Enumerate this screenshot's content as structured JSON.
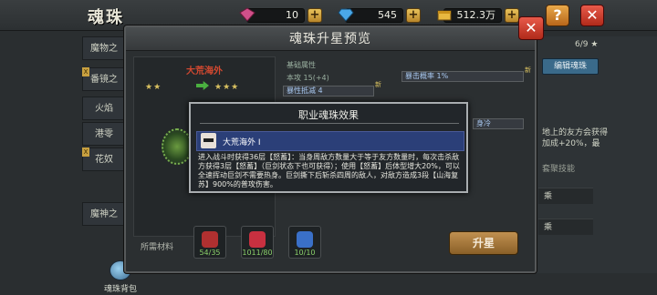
{
  "header": {
    "title": "魂珠",
    "resources": [
      {
        "icon": "pink-gem-icon",
        "value": "10",
        "color": "#d0508a"
      },
      {
        "icon": "blue-diamond-icon",
        "value": "545",
        "color": "#4aa8e8"
      },
      {
        "icon": "gold-chest-icon",
        "value": "512.3万",
        "color": "#e8b840"
      }
    ],
    "help_label": "?",
    "close_label": "✕"
  },
  "sidebar": {
    "items": [
      "魔物之",
      "番镜之",
      "火焰",
      "港零",
      "花奴",
      "魔神之"
    ],
    "bag_label": "魂珠背包"
  },
  "right_panel": {
    "count": "6/9 ★",
    "button_label": "编辑魂珠",
    "text": "地上的友方会获得加成+20%，最",
    "section": "套聚技能",
    "row1": "乘",
    "row2": "乘"
  },
  "dialog": {
    "title": "魂珠升星预览",
    "close_label": "✕",
    "card": {
      "name": "大荒海外",
      "stars_left": "★★",
      "stars_right": "★★★"
    },
    "attrs": {
      "base_label": "基础属性",
      "base_value": "本攻 15(+4)",
      "box1": "暴击概率 1%",
      "box2": "暴性抵减 4",
      "box3": "身冷",
      "new_flag": "新"
    },
    "materials_label": "所需材料",
    "materials": [
      {
        "icon": "red-fragment-icon",
        "count": "54/35",
        "color": "#b03030"
      },
      {
        "icon": "red-crystal-icon",
        "count": "1011/80",
        "color": "#c83040"
      },
      {
        "icon": "potion-jar-icon",
        "count": "10/10",
        "color": "#3a70c8"
      }
    ],
    "upgrade_label": "升星"
  },
  "modal": {
    "title": "职业魂珠效果",
    "skill_name": "大荒海外 I",
    "description": "进入战斗时获得36层【怒蓄】：当身周敌方数量大于等于友方数量时，每次击杀敌方获得3层【怒蓄】（巨剑状态下也可获得）；使用【怒蓄】后体型增大20%，可以全速挥动巨剑不需要热身。巨剑撕下后斩杀四周的敌人，对敌方造成3段【山海复苏】900%的普攻伤害。"
  }
}
